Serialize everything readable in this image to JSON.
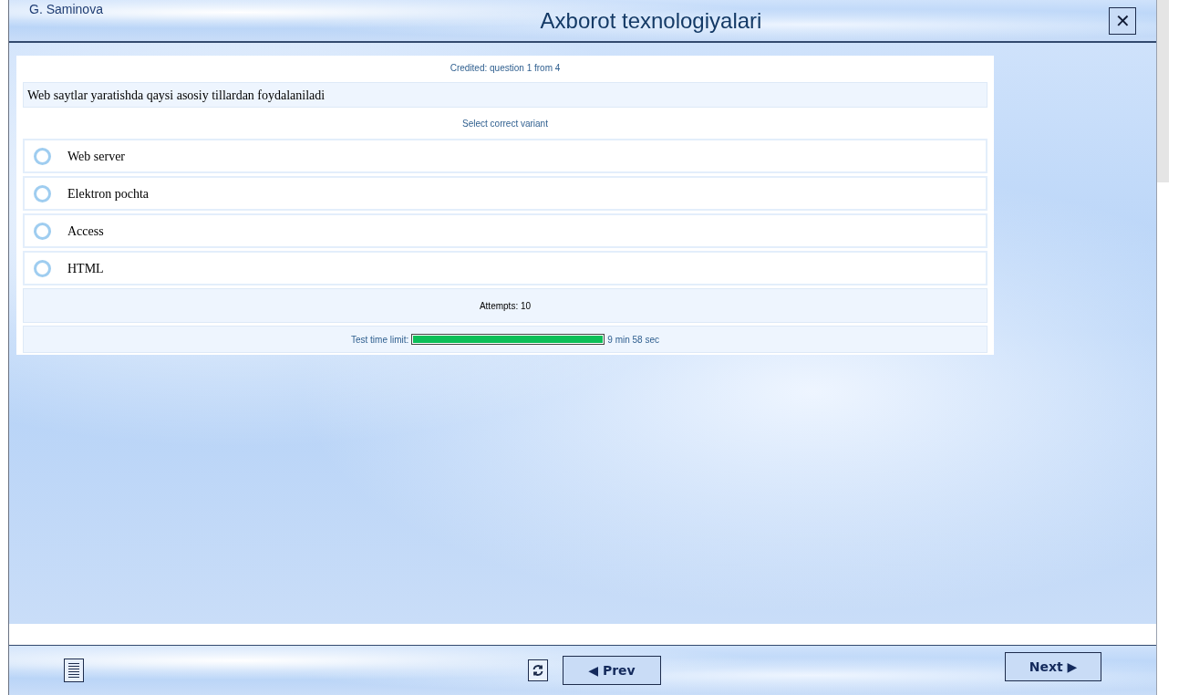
{
  "header": {
    "user": "G. Saminova",
    "title": "Axborot texnologiyalari",
    "close": "✕"
  },
  "quiz": {
    "progress": "Credited: question 1 from 4",
    "question": "Web saytlar yaratishda qaysi asosiy tillardan foydalaniladi",
    "instruction": "Select correct variant",
    "options": [
      {
        "label": "Web server",
        "selected": false
      },
      {
        "label": "Elektron pochta",
        "selected": false
      },
      {
        "label": "Access",
        "selected": false
      },
      {
        "label": "HTML",
        "selected": false
      }
    ],
    "attempts": "Attempts: 10",
    "timer": {
      "label": "Test time limit:",
      "level": 1,
      "reading": "9 min 58 sec"
    }
  },
  "footer": {
    "prev": "◀ Prev",
    "next": "Next ▶"
  }
}
